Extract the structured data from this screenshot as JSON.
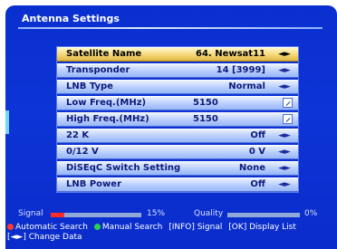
{
  "screen": {
    "title": "Antenna Settings"
  },
  "menu": [
    {
      "label": "Satellite Name",
      "value": "64. Newsat11",
      "control": "arrows",
      "selected": true
    },
    {
      "label": "Transponder",
      "value": "14 [3999]",
      "control": "arrows"
    },
    {
      "label": "LNB Type",
      "value": "Normal",
      "control": "arrows"
    },
    {
      "label": "Low Freq.(MHz)",
      "value": "5150",
      "control": "edit"
    },
    {
      "label": "High Freq.(MHz)",
      "value": "5150",
      "control": "edit"
    },
    {
      "label": "22 K",
      "value": "Off",
      "control": "arrows"
    },
    {
      "label": "0/12 V",
      "value": "0 V",
      "control": "arrows"
    },
    {
      "label": "DiSEqC Switch Setting",
      "value": "None",
      "control": "arrows"
    },
    {
      "label": "LNB Power",
      "value": "Off",
      "control": "arrows"
    }
  ],
  "signal": {
    "label": "Signal",
    "percent_text": "15%",
    "level": 0.15
  },
  "quality": {
    "label": "Quality",
    "percent_text": "0%",
    "level": 0.0
  },
  "footer": {
    "auto_search": "Automatic Search",
    "manual_search": "Manual Search",
    "info_text": "[INFO] Signal",
    "ok_text": "[OK] Display List",
    "change_data": "[◄►] Change Data"
  },
  "colors": {
    "background": "#0d34d6",
    "selected_row": "#f4d676",
    "row": "#b7cdfd",
    "auto_search_dot": "#ff3b2a",
    "manual_search_dot": "#2ad24b"
  },
  "icons": {
    "arrows": "left-right-arrows-icon",
    "edit": "edit-icon"
  }
}
